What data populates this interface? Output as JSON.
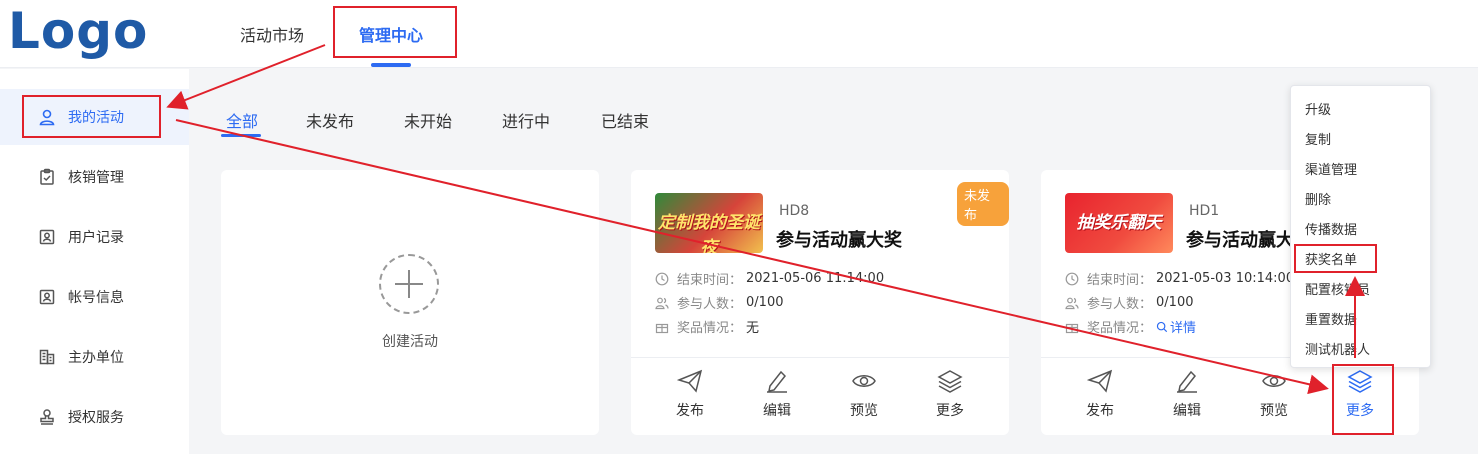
{
  "header": {
    "logo": "Logo",
    "nav": [
      {
        "label": "活动市场"
      },
      {
        "label": "管理中心"
      }
    ]
  },
  "sidebar": {
    "items": [
      {
        "label": "我的活动",
        "icon": "user-icon"
      },
      {
        "label": "核销管理",
        "icon": "clipboard-check-icon"
      },
      {
        "label": "用户记录",
        "icon": "contact-card-icon"
      },
      {
        "label": "帐号信息",
        "icon": "id-card-icon"
      },
      {
        "label": "主办单位",
        "icon": "building-icon"
      },
      {
        "label": "授权服务",
        "icon": "stamp-icon"
      }
    ]
  },
  "tabs": [
    {
      "label": "全部"
    },
    {
      "label": "未发布"
    },
    {
      "label": "未开始"
    },
    {
      "label": "进行中"
    },
    {
      "label": "已结束"
    }
  ],
  "create_card": {
    "label": "创建活动"
  },
  "cards": [
    {
      "code": "HD8",
      "title": "参与活动赢大奖",
      "badge": "未发布",
      "thumb_text": "定制我的圣诞夜",
      "end_label": "结束时间：",
      "end_time": "2021-05-06 11:14:00",
      "people_label": "参与人数：",
      "people": "0/100",
      "prize_label": "奖品情况：",
      "prize": "无",
      "actions": [
        "发布",
        "编辑",
        "预览",
        "更多"
      ]
    },
    {
      "code": "HD1",
      "title": "参与活动赢大奖",
      "thumb_text": "抽奖乐翻天",
      "end_label": "结束时间：",
      "end_time": "2021-05-03 10:14:00",
      "people_label": "参与人数：",
      "people": "0/100",
      "prize_label": "奖品情况：",
      "prize": "详情",
      "actions": [
        "发布",
        "编辑",
        "预览",
        "更多"
      ]
    }
  ],
  "dropdown": {
    "items": [
      "升级",
      "复制",
      "渠道管理",
      "删除",
      "传播数据",
      "获奖名单",
      "配置核销员",
      "重置数据",
      "测试机器人"
    ]
  },
  "colors": {
    "accent": "#2d6bf2",
    "badge": "#f7a23b",
    "highlight": "#e0212b"
  }
}
